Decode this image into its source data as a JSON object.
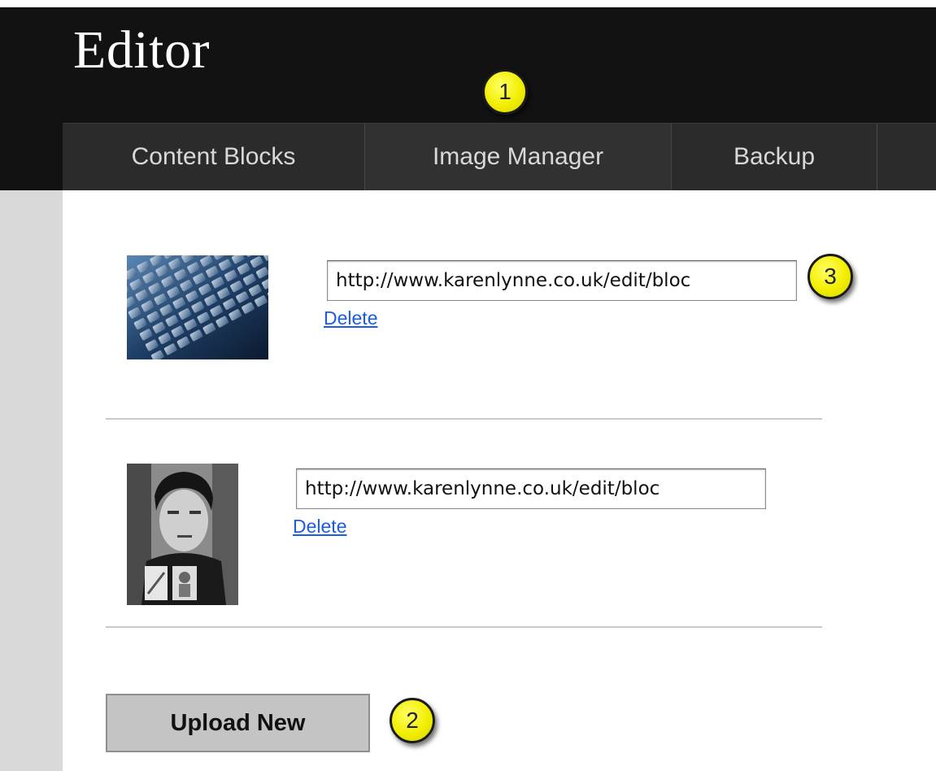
{
  "app": {
    "title": "Editor"
  },
  "nav": {
    "tabs": [
      {
        "label": "Content Blocks"
      },
      {
        "label": "Image Manager"
      },
      {
        "label": "Backup"
      }
    ]
  },
  "images": [
    {
      "url": "http://www.karenlynne.co.uk/edit/bloc",
      "delete_label": "Delete",
      "thumbnail": "keyboard-photo"
    },
    {
      "url": "http://www.karenlynne.co.uk/edit/bloc",
      "delete_label": "Delete",
      "thumbnail": "portrait-photo"
    }
  ],
  "upload": {
    "label": "Upload New"
  },
  "callouts": [
    {
      "number": "1"
    },
    {
      "number": "2"
    },
    {
      "number": "3"
    }
  ],
  "colors": {
    "header_bg": "#121212",
    "nav_bg": "#2b2b2b",
    "link": "#1a5ce6",
    "callout": "#f2ee00",
    "sidebar": "#d9d9d9"
  }
}
